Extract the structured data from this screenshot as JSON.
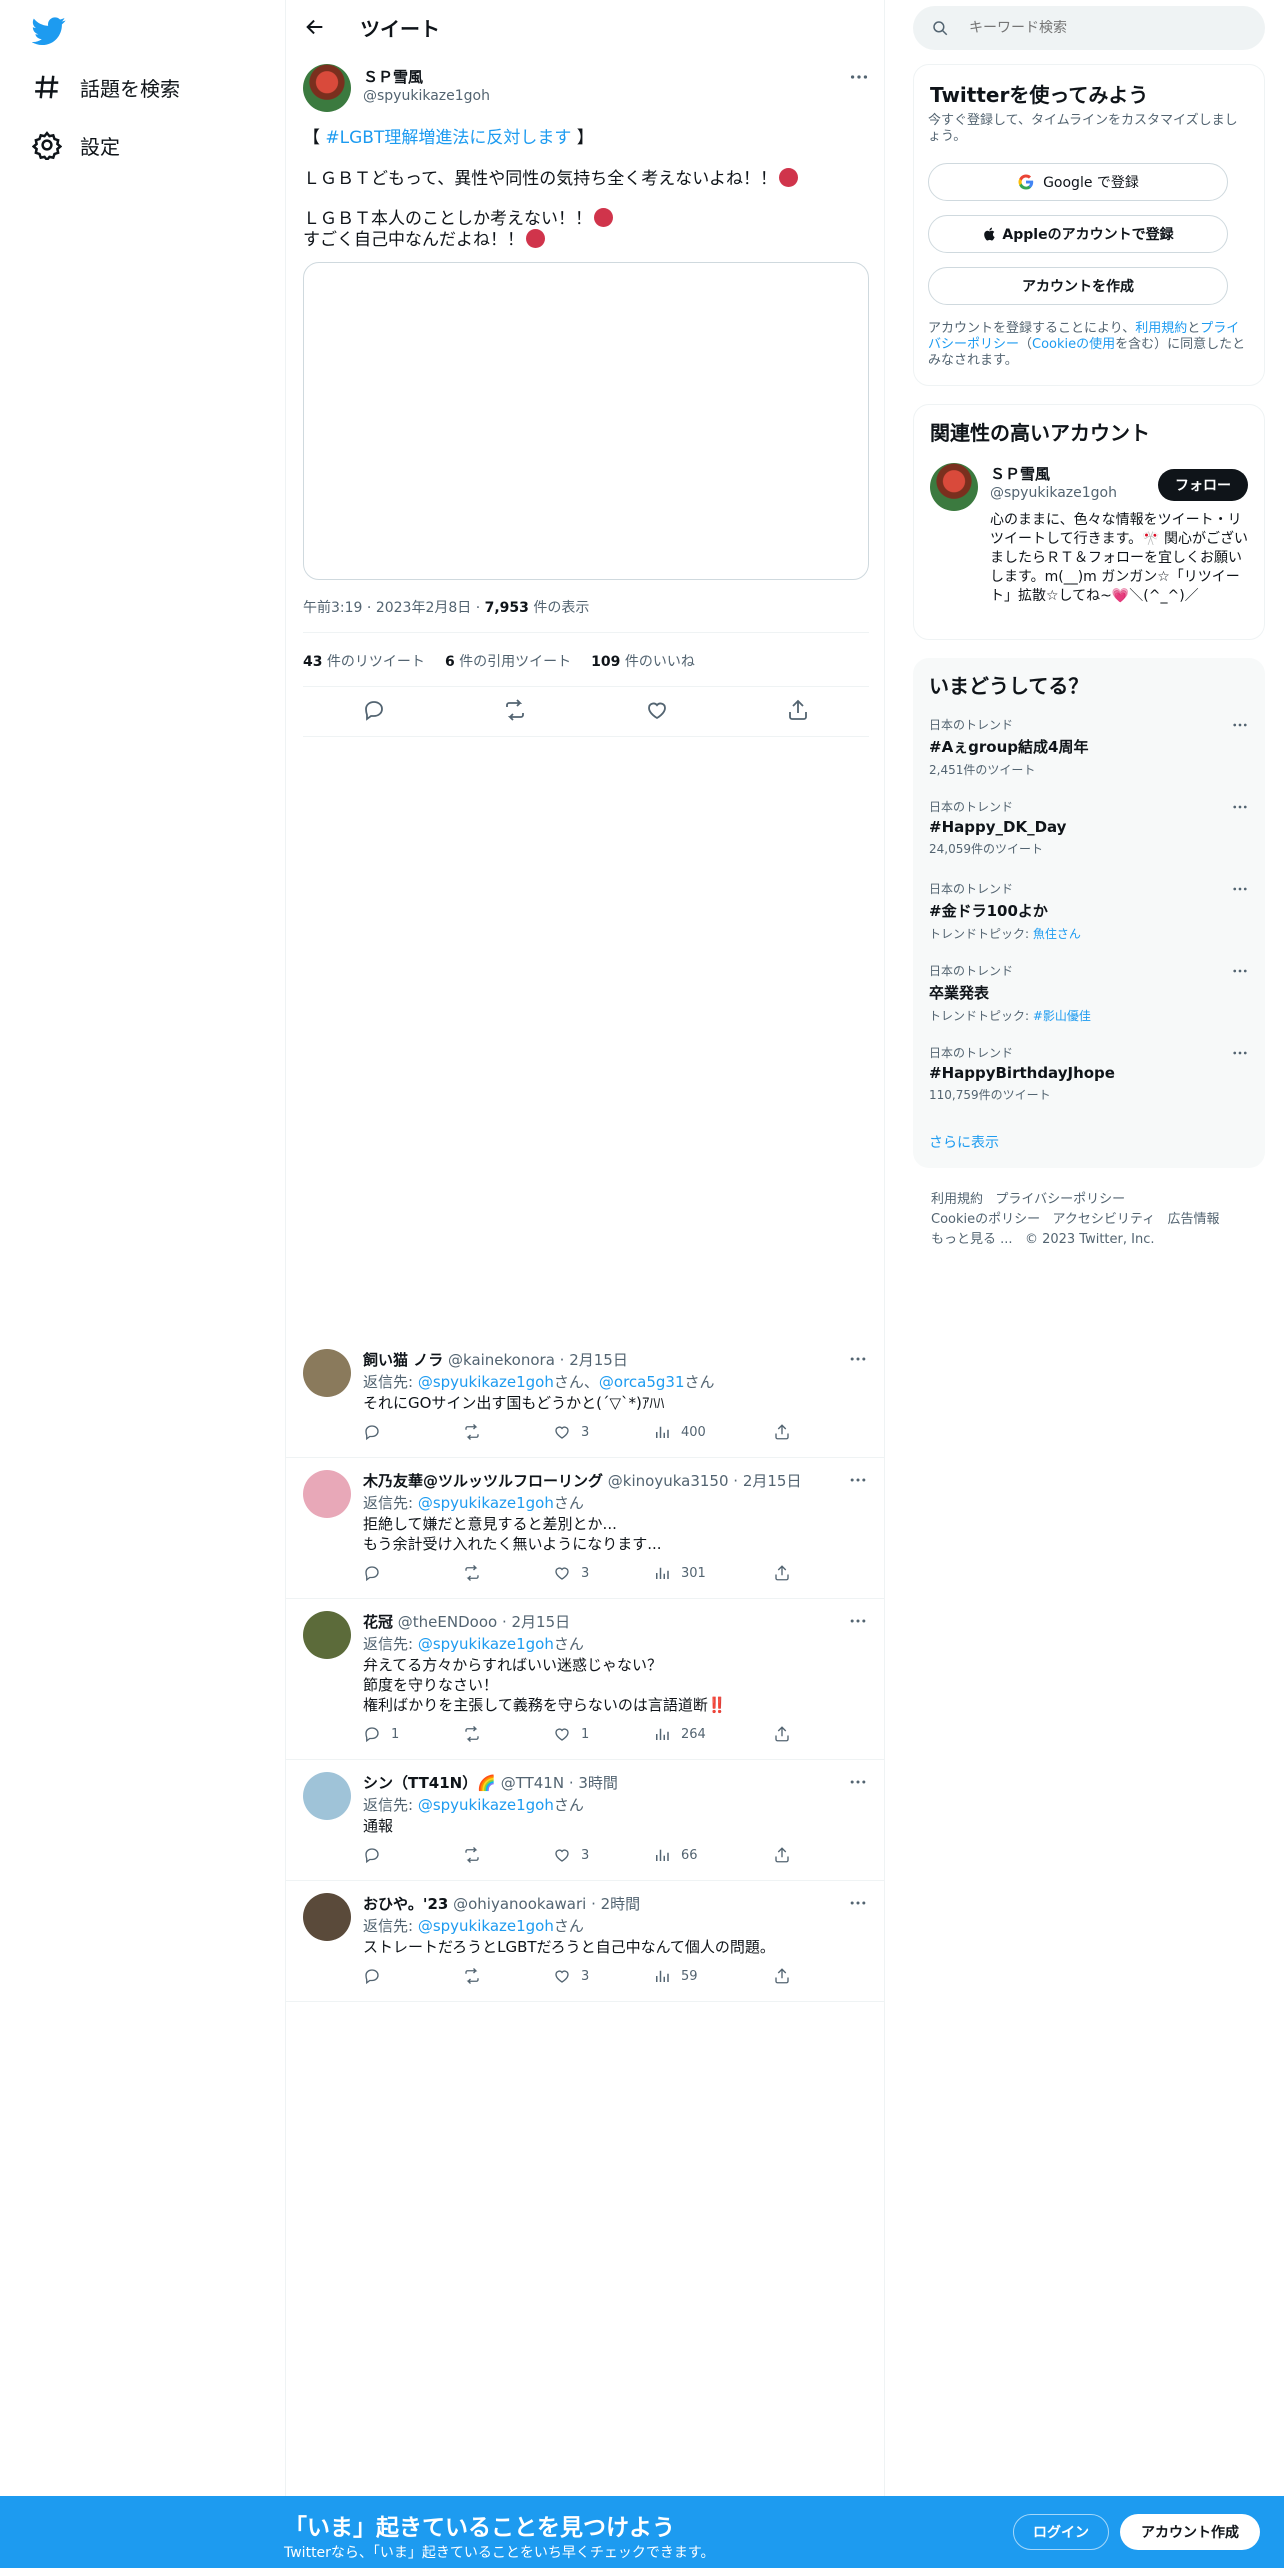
{
  "nav": {
    "explore": "話題を検索",
    "settings": "設定"
  },
  "header": {
    "title": "ツイート"
  },
  "tweet": {
    "name": "ＳＰ雪風",
    "handle": "@spyukikaze1goh",
    "line1_pre": "【 ",
    "line1_tag": "#LGBT理解増進法に反対します",
    "line1_post": " 】",
    "line2": "ＬＧＢＴどもって、異性や同性の気持ち全く考えないよね！！",
    "line3": "ＬＧＢＴ本人のことしか考えない！！",
    "line4": "すごく自己中なんだよね！！",
    "time": "午前3:19",
    "date": "2023年2月8日",
    "views_num": "7,953",
    "views_label": " 件の表示",
    "retweets_num": "43",
    "retweets_label": " 件のリツイート",
    "quotes_num": "6",
    "quotes_label": " 件の引用ツイート",
    "likes_num": "109",
    "likes_label": " 件のいいね"
  },
  "replies": [
    {
      "name": "飼い猫 ノラ",
      "handle": "@kainekonora",
      "time": "2月15日",
      "to_prefix": "返信先: ",
      "to1": "@spyukikaze1goh",
      "to_mid": "さん、",
      "to2": "@orca5g31",
      "to_suffix": "さん",
      "lines": [
        "それにGOサイン出す国もどうかと(´▽`*)ｱﾊﾊ"
      ],
      "replies": "",
      "retweets": "",
      "likes": "3",
      "views": "400",
      "avatar": "#8a7a5c"
    },
    {
      "name": "木乃友華@ツルッツルフローリング",
      "handle": "@kinoyuka3150",
      "time": "2月15日",
      "to_prefix": "返信先: ",
      "to1": "@spyukikaze1goh",
      "to_mid": "",
      "to2": "",
      "to_suffix": "さん",
      "lines": [
        "拒絶して嫌だと意見すると差別とか...",
        "もう余計受け入れたく無いようになります..."
      ],
      "replies": "",
      "retweets": "",
      "likes": "3",
      "views": "301",
      "avatar": "#e8a8b8"
    },
    {
      "name": "花冠",
      "handle": "@theENDooo",
      "time": "2月15日",
      "to_prefix": "返信先: ",
      "to1": "@spyukikaze1goh",
      "to_mid": "",
      "to2": "",
      "to_suffix": "さん",
      "lines": [
        "弁えてる方々からすればいい迷惑じゃない？",
        "節度を守りなさい！",
        "権利ばかりを主張して義務を守らないのは言語道断‼️"
      ],
      "replies": "1",
      "retweets": "",
      "likes": "1",
      "views": "264",
      "avatar": "#5c6b3a"
    },
    {
      "name": "シン（TT41N）🌈",
      "handle": "@TT41N",
      "time": "3時間",
      "to_prefix": "返信先: ",
      "to1": "@spyukikaze1goh",
      "to_mid": "",
      "to2": "",
      "to_suffix": "さん",
      "lines": [
        "通報"
      ],
      "replies": "",
      "retweets": "",
      "likes": "3",
      "views": "66",
      "avatar": "#9fc3d8"
    },
    {
      "name": "おひや。'23",
      "handle": "@ohiyanookawari",
      "time": "2時間",
      "to_prefix": "返信先: ",
      "to1": "@spyukikaze1goh",
      "to_mid": "",
      "to2": "",
      "to_suffix": "さん",
      "lines": [
        "ストレートだろうとLGBTだろうと自己中なんて個人の問題。"
      ],
      "replies": "",
      "retweets": "",
      "likes": "3",
      "views": "59",
      "avatar": "#5a4a3a"
    }
  ],
  "search": {
    "placeholder": "キーワード検索"
  },
  "signup": {
    "title": "Twitterを使ってみよう",
    "subtitle": "今すぐ登録して、タイムラインをカスタマイズしましょう。",
    "google": "Google で登録",
    "apple": "Appleのアカウントで登録",
    "create": "アカウントを作成",
    "terms_pre": "アカウントを登録することにより、",
    "terms_link": "利用規約",
    "terms_mid": "と",
    "privacy_link": "プライバシーポリシー",
    "terms_mid2": "（",
    "cookie_link": "Cookieの使用",
    "terms_post": "を含む）に同意したとみなされます。"
  },
  "related": {
    "title": "関連性の高いアカウント",
    "name": "ＳＰ雪風",
    "handle": "@spyukikaze1goh",
    "follow": "フォロー",
    "bio": "心のままに、色々な情報をツイート・リツイートして行きます。🎌 関心がございましたらＲＴ＆フォローを宜しくお願いします。m(__)m ガンガン☆「リツイート」拡散☆してね~💗＼(^_^)／"
  },
  "trends": {
    "title": "いまどうしてる？",
    "items": [
      {
        "cat": "日本のトレンド",
        "name": "#Aぇgroup結成4周年",
        "sub_pre": "2,451件のツイート",
        "sub_link": ""
      },
      {
        "cat": "日本のトレンド",
        "name": "#Happy_DK_Day",
        "sub_pre": "24,059件のツイート",
        "sub_link": ""
      },
      {
        "cat": "日本のトレンド",
        "name": "#金ドラ100よか",
        "sub_pre": "トレンドトピック: ",
        "sub_link": "魚住さん"
      },
      {
        "cat": "日本のトレンド",
        "name": "卒業発表",
        "sub_pre": "トレンドトピック: ",
        "sub_link": "#影山優佳"
      },
      {
        "cat": "日本のトレンド",
        "name": "#HappyBirthdayJhope",
        "sub_pre": "110,759件のツイート",
        "sub_link": ""
      }
    ],
    "more": "さらに表示"
  },
  "footer": {
    "terms": "利用規約",
    "privacy": "プライバシーポリシー",
    "cookie": "Cookieのポリシー",
    "access": "アクセシビリティ",
    "ads": "広告情報",
    "more": "もっと見る ...",
    "copy": "© 2023 Twitter, Inc."
  },
  "bottombar": {
    "title": "「いま」起きていることを見つけよう",
    "sub": "Twitterなら、「いま」起きていることをいち早くチェックできます。",
    "login": "ログイン",
    "signup": "アカウント作成"
  },
  "colors": {
    "accent": "#1d9bf0",
    "text": "#0f1419",
    "muted": "#536471"
  }
}
